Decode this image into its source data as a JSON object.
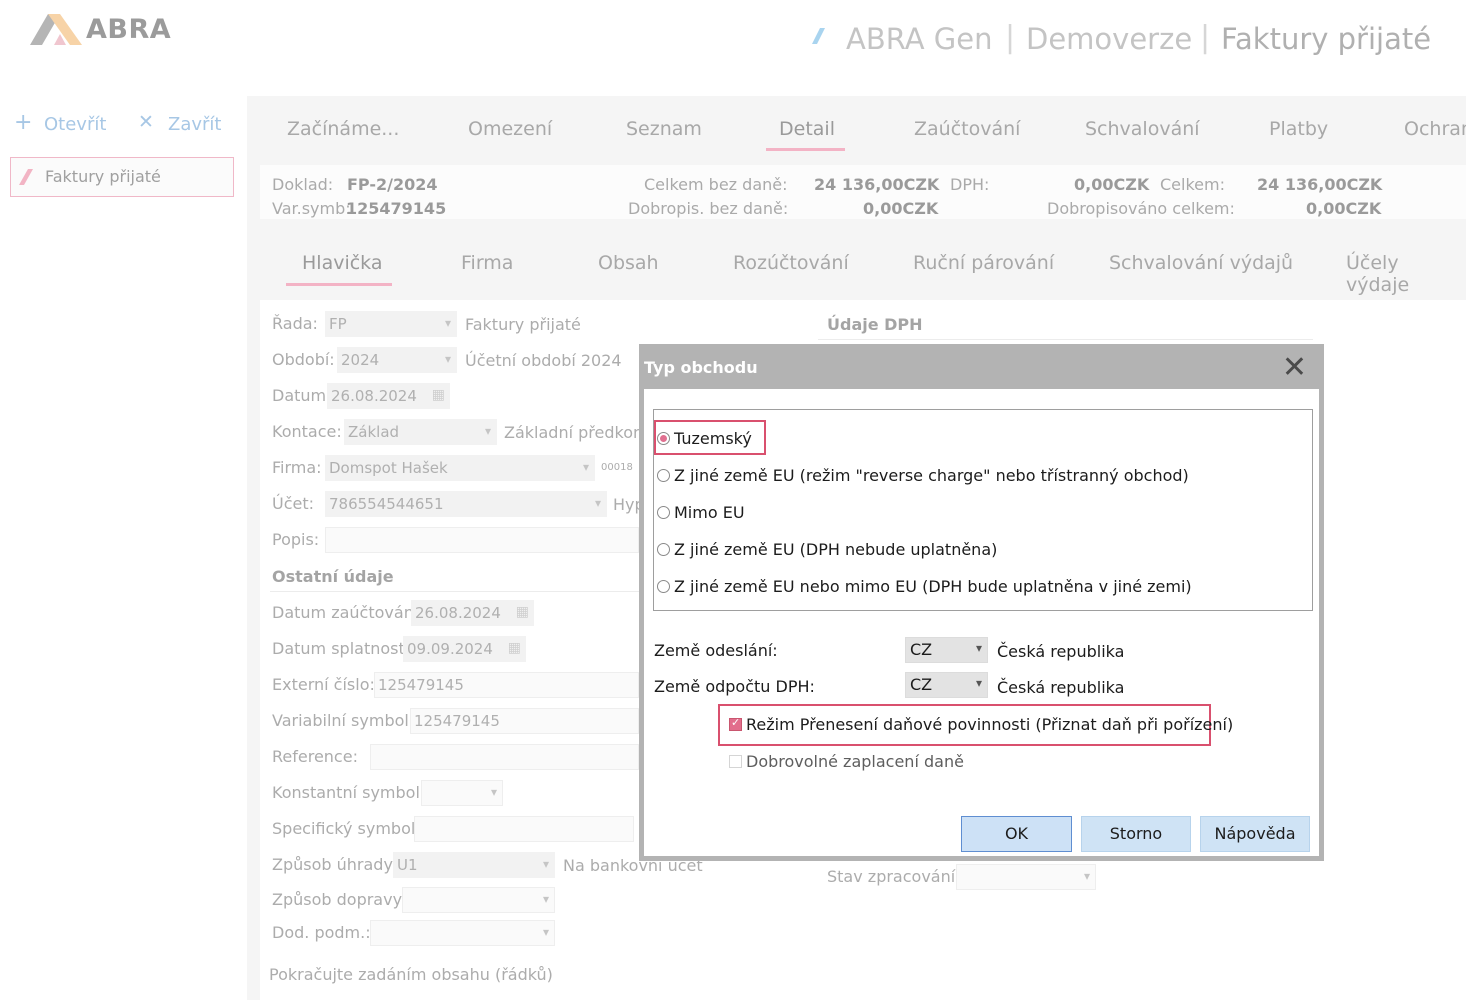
{
  "header": {
    "logo_text": "ABRA",
    "title_parts": [
      "ABRA Gen",
      "Demoverze",
      "Faktury přijaté"
    ]
  },
  "toolbar": {
    "open_label": "Otevřít",
    "close_label": "Zavřít"
  },
  "left_list": {
    "item": "Faktury přijaté"
  },
  "main_tabs": [
    "Začínáme...",
    "Omezení",
    "Seznam",
    "Detail",
    "Zaúčtování",
    "Schvalování",
    "Platby",
    "Ochran"
  ],
  "info": {
    "doklad_label": "Doklad:",
    "doklad_value": "FP-2/2024",
    "varsymb_label": "Var.symb:",
    "varsymb_value": "125479145",
    "celkem_bez_dane_label": "Celkem bez daně:",
    "celkem_bez_dane_value": "24 136,00CZK",
    "dph_label": "DPH:",
    "dph_value": "0,00CZK",
    "celkem_label": "Celkem:",
    "celkem_value": "24 136,00CZK",
    "dobropis_label": "Dobropis. bez daně:",
    "dobropis_value": "0,00CZK",
    "dobropisovano_label": "Dobropisováno celkem:",
    "dobropisovano_value": "0,00CZK"
  },
  "sub_tabs": [
    "Hlavička",
    "Firma",
    "Obsah",
    "Rozúčtování",
    "Ruční párování",
    "Schvalování výdajů",
    "Účely výdaje"
  ],
  "form": {
    "rada_label": "Řada:",
    "rada_value": "FP",
    "rada_desc": "Faktury přijaté",
    "obdobi_label": "Období:",
    "obdobi_value": "2024",
    "obdobi_desc": "Účetní období 2024",
    "datum_label": "Datum:",
    "datum_value": "26.08.2024",
    "kontace_label": "Kontace:",
    "kontace_value": "Základ",
    "kontace_desc": "Základní předkonta",
    "firma_label": "Firma:",
    "firma_value": "Domspot Hašek",
    "firma_code": "00018",
    "ucet_label": "Účet:",
    "ucet_value": "786554544651",
    "ucet_desc": "Hyp",
    "popis_label": "Popis:",
    "ostatni_label": "Ostatní údaje",
    "datum_zauct_label": "Datum zaúčtování:",
    "datum_zauct_value": "26.08.2024",
    "datum_splat_label": "Datum splatnosti:",
    "datum_splat_value": "09.09.2024",
    "externi_label": "Externí číslo:",
    "externi_value": "125479145",
    "varsym_label": "Variabilní symbol:",
    "varsym_value": "125479145",
    "reference_label": "Reference:",
    "konst_label": "Konstantní symbol:",
    "spec_label": "Specifický symbol:",
    "zpusob_uhrady_label": "Způsob úhrady:",
    "zpusob_uhrady_value": "U1",
    "zpusob_uhrady_desc": "Na bankovní účet",
    "zpusob_dopravy_label": "Způsob dopravy:",
    "dod_podm_label": "Dod. podm.:",
    "footer_hint": "Pokračujte zadáním obsahu (řádků)",
    "udaje_dph_label": "Údaje DPH",
    "stav_label": "Stav zpracování:"
  },
  "dialog": {
    "title": "Typ obchodu",
    "options": [
      {
        "text": "Tuzemský",
        "selected": true
      },
      {
        "text": "Z jiné země EU (režim \"reverse charge\" nebo třístranný obchod)",
        "selected": false
      },
      {
        "text": "Mimo EU",
        "selected": false
      },
      {
        "text": "Z jiné země EU (DPH nebude uplatněna)",
        "selected": false
      },
      {
        "text": "Z jiné země EU nebo mimo EU (DPH bude uplatněna v jiné zemi)",
        "selected": false
      }
    ],
    "zeme_odeslani_label": "Země odeslání:",
    "zeme_odeslani_code": "CZ",
    "zeme_odeslani_name": "Česká republika",
    "zeme_odpoctu_label": "Země odpočtu DPH:",
    "zeme_odpoctu_code": "CZ",
    "zeme_odpoctu_name": "Česká republika",
    "rezim_label": "Režim Přenesení daňové povinnosti (Přiznat daň při pořízení)",
    "dobrovolne_label": "Dobrovolné zaplacení daně",
    "ok": "OK",
    "storno": "Storno",
    "napoveda": "Nápověda"
  },
  "colors": {
    "accent_pink": "#d9506e",
    "dialog_gray": "#b3b3b3",
    "button_blue": "#cfe3f5"
  }
}
